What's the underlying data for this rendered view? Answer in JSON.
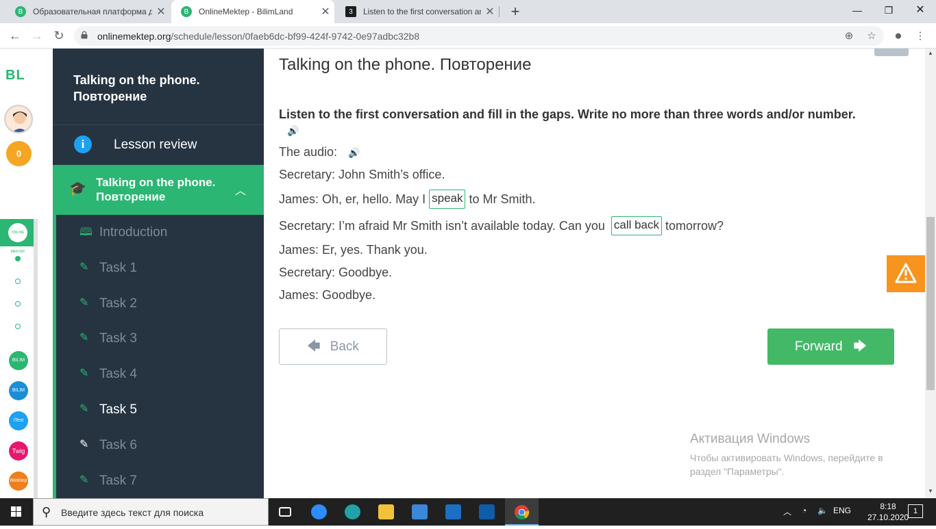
{
  "browser": {
    "tabs": [
      {
        "title": "Образовательная платформа д",
        "favicon": "B",
        "active": false
      },
      {
        "title": "OnlineMektep - BilimLand",
        "favicon": "B",
        "active": true
      },
      {
        "title": "Listen to the first conversation an",
        "favicon": "3",
        "active": false
      }
    ],
    "url_host": "onlinemektep.org",
    "url_path": "/schedule/lesson/0faeb6dc-bf99-424f-9742-0e97adbc32b8"
  },
  "rail": {
    "logo": "BL",
    "coins": "0",
    "active_app": "ONLINE MEKTEP",
    "apps": [
      "BILIM Land",
      "BILIM Book",
      "iTest",
      "Twig",
      "iMektep"
    ]
  },
  "sidebar": {
    "title": "Talking on the phone. Повторение",
    "review_label": "Lesson review",
    "section_label": "Talking on the phone. Повторение",
    "items": [
      {
        "label": "Introduction"
      },
      {
        "label": "Task 1"
      },
      {
        "label": "Task 2"
      },
      {
        "label": "Task 3"
      },
      {
        "label": "Task 4"
      },
      {
        "label": "Task 5"
      },
      {
        "label": "Task 6"
      },
      {
        "label": "Task 7"
      }
    ]
  },
  "main": {
    "title": "Talking on the phone. Повторение",
    "instruction": "Listen to the first conversation and fill in the gaps. Write no more than three words and/or number.",
    "audio_label": "The audio:",
    "dialogue": {
      "l1": "Secretary: John Smith’s office.",
      "l2_a": "James: Oh, er, hello. May I",
      "l2_gap": "speak",
      "l2_b": "to Mr Smith.",
      "l3_a": "Secretary: I’m afraid Mr Smith isn’t available today. Can you",
      "l3_gap": "call back",
      "l3_b": "tomorrow?",
      "l4": "James: Er, yes. Thank you.",
      "l5": "Secretary: Goodbye.",
      "l6": "James: Goodbye."
    },
    "back_label": "Back",
    "forward_label": "Forward"
  },
  "activation": {
    "title": "Активация Windows",
    "text": "Чтобы активировать Windows, перейдите в раздел \"Параметры\"."
  },
  "taskbar": {
    "search_placeholder": "Введите здесь текст для поиска",
    "lang": "ENG",
    "time": "8:18",
    "date": "27.10.2020",
    "notifications": "1"
  },
  "colors": {
    "brand_green": "#2bb673",
    "sidebar_bg": "#263442",
    "warning_orange": "#f7941d"
  }
}
